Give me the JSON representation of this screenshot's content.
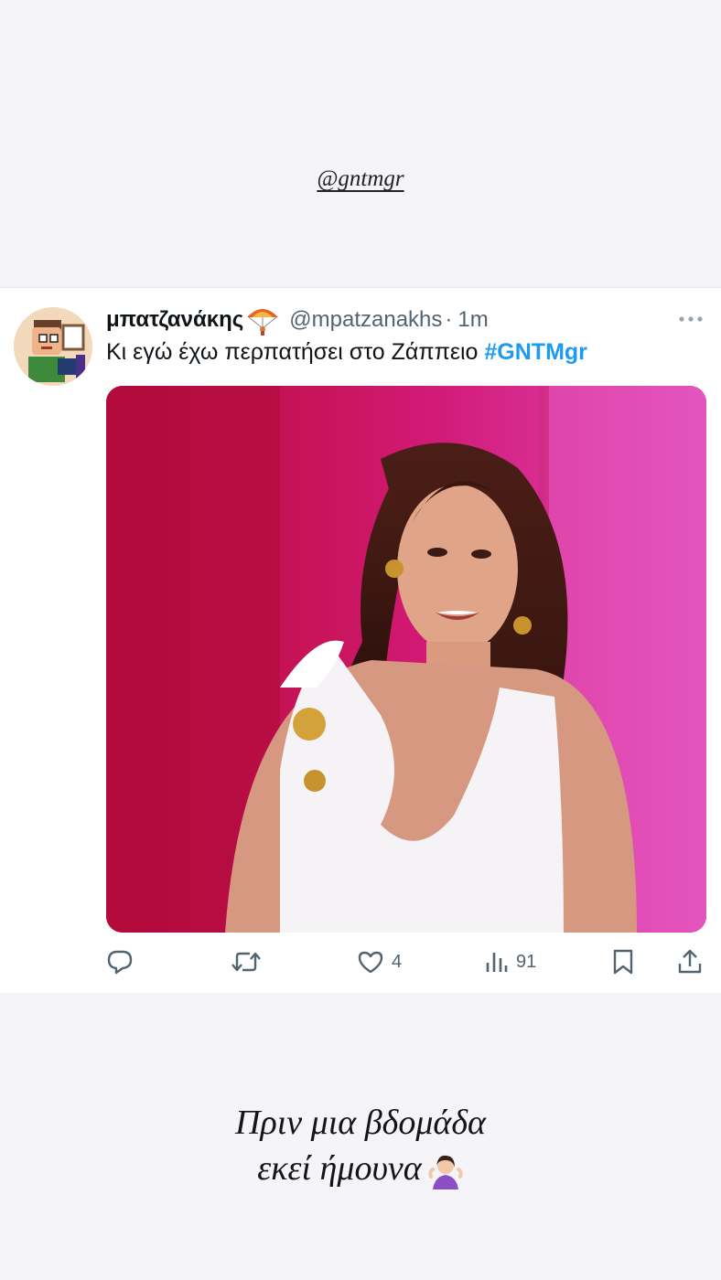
{
  "story": {
    "mention": "@gntmgr",
    "caption_line1": "Πριν μια βδομάδα",
    "caption_line2": "εκεί ήμουνα"
  },
  "tweet": {
    "display_name": "μπατζανάκης",
    "name_emoji": "parachute-emoji",
    "handle": "@mpatzanakhs",
    "separator": "·",
    "time": "1m",
    "text": "Κι εγώ έχω περπατήσει στο Ζάππειο ",
    "hashtag": "#GNTMgr",
    "media_description_icon": "tv-host-photo",
    "actions": {
      "reply_count": "",
      "retweet_count": "",
      "like_count": "4",
      "views_count": "91"
    }
  },
  "colors": {
    "hashtag": "#1d9bf0",
    "secondary_text": "#536471",
    "story_bg": "#f4f4f9",
    "media_backdrop": "#c0104a"
  }
}
